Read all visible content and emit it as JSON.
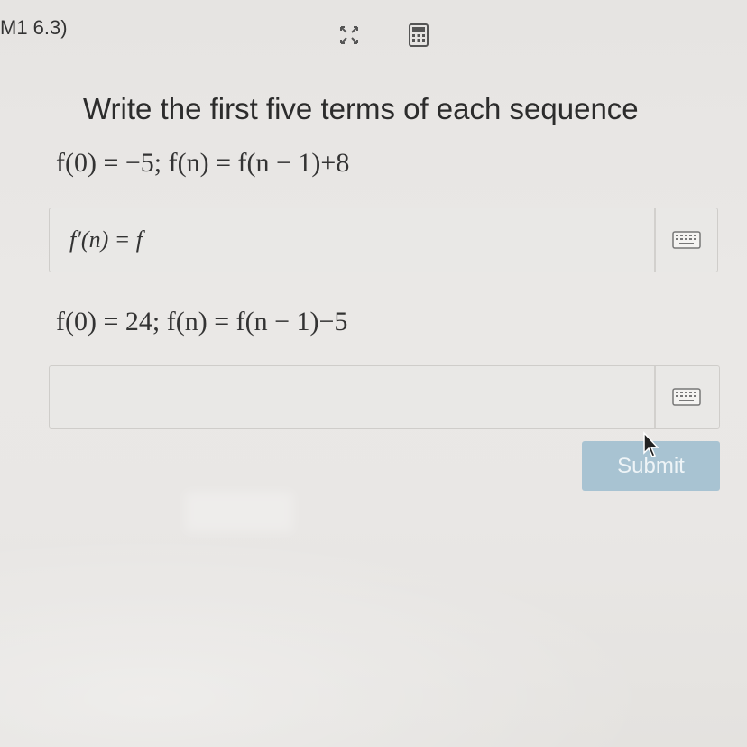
{
  "header": {
    "course_label": "M1 6.3)",
    "expand_icon": "expand-arrows-icon",
    "calculator_icon": "calculator-icon"
  },
  "question": {
    "prompt": "Write the first five terms of each sequence"
  },
  "problems": [
    {
      "equation": "f(0) = −5; f(n) = f(n − 1)+8",
      "answer_value": "f′(n) = f",
      "keyboard_icon": "keyboard-icon"
    },
    {
      "equation": "f(0) = 24; f(n) = f(n − 1)−5",
      "answer_value": "",
      "keyboard_icon": "keyboard-icon"
    }
  ],
  "actions": {
    "submit_label": "Submit"
  },
  "colors": {
    "submit_bg": "#a8c3d2",
    "answer_box_bg": "#e9e8e6"
  }
}
